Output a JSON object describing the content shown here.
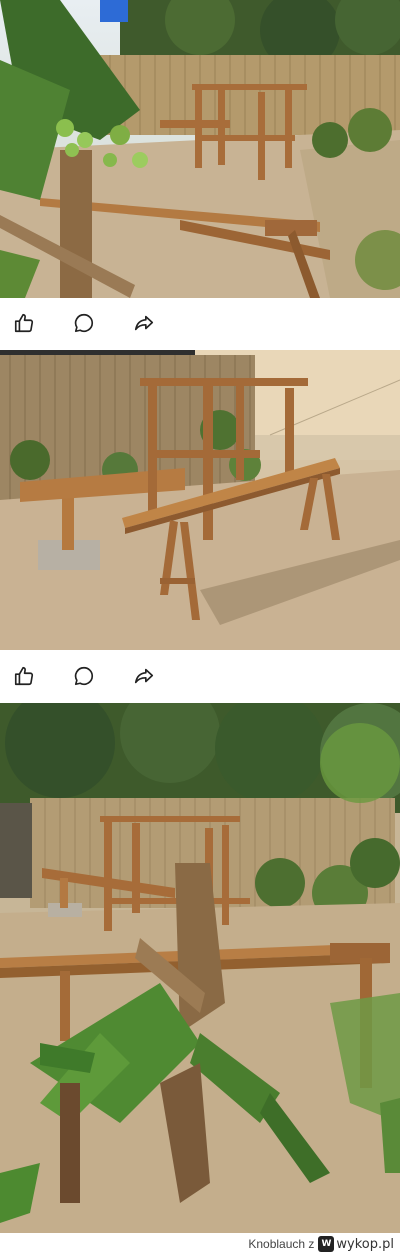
{
  "posts": [
    {
      "actions": {
        "like_icon": "thumbs-up-icon",
        "comment_icon": "comment-icon",
        "share_icon": "share-icon"
      }
    },
    {
      "actions": {
        "like_icon": "thumbs-up-icon",
        "comment_icon": "comment-icon",
        "share_icon": "share-icon"
      }
    }
  ],
  "footer": {
    "credit": "Knoblauch z",
    "brand_name": "wykop.pl",
    "brand_logo_text": "W"
  }
}
